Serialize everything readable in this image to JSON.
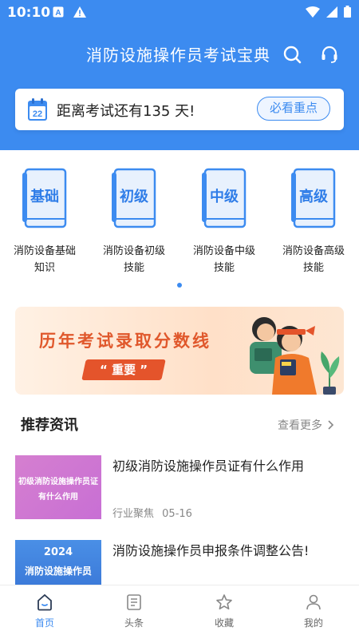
{
  "status_bar": {
    "time": "10:10"
  },
  "header": {
    "title": "消防设施操作员考试宝典",
    "icons": [
      "search-icon",
      "headset-icon"
    ],
    "bg_color": "#3c8bf0"
  },
  "countdown": {
    "calendar_day": "22",
    "text": "距离考试还有135 天!",
    "button_label": "必看重点"
  },
  "categories": [
    {
      "book_title": "基础",
      "label_line1": "消防设备基础",
      "label_line2": "知识"
    },
    {
      "book_title": "初级",
      "label_line1": "消防设备初级",
      "label_line2": "技能"
    },
    {
      "book_title": "中级",
      "label_line1": "消防设备中级",
      "label_line2": "技能"
    },
    {
      "book_title": "高级",
      "label_line1": "消防设备高级",
      "label_line2": "技能"
    }
  ],
  "banner": {
    "title": "历年考试录取分数线",
    "badge": "“ 重要 ”",
    "accent_color": "#e4542b"
  },
  "recommend": {
    "title": "推荐资讯",
    "see_more": "查看更多"
  },
  "news": [
    {
      "thumb_line1": "初级消防设施操作员证",
      "thumb_line2": "有什么作用",
      "title": "初级消防设施操作员证有什么作用",
      "category": "行业聚焦",
      "date": "05-16"
    },
    {
      "thumb_line1": "2024",
      "thumb_line2": "消防设施操作员",
      "title": "消防设施操作员申报条件调整公告!"
    }
  ],
  "tabbar": {
    "items": [
      {
        "label": "首页",
        "icon": "home-icon",
        "active": true
      },
      {
        "label": "头条",
        "icon": "news-icon",
        "active": false
      },
      {
        "label": "收藏",
        "icon": "star-icon",
        "active": false
      },
      {
        "label": "我的",
        "icon": "user-icon",
        "active": false
      }
    ],
    "active_color": "#3c8bf0"
  }
}
